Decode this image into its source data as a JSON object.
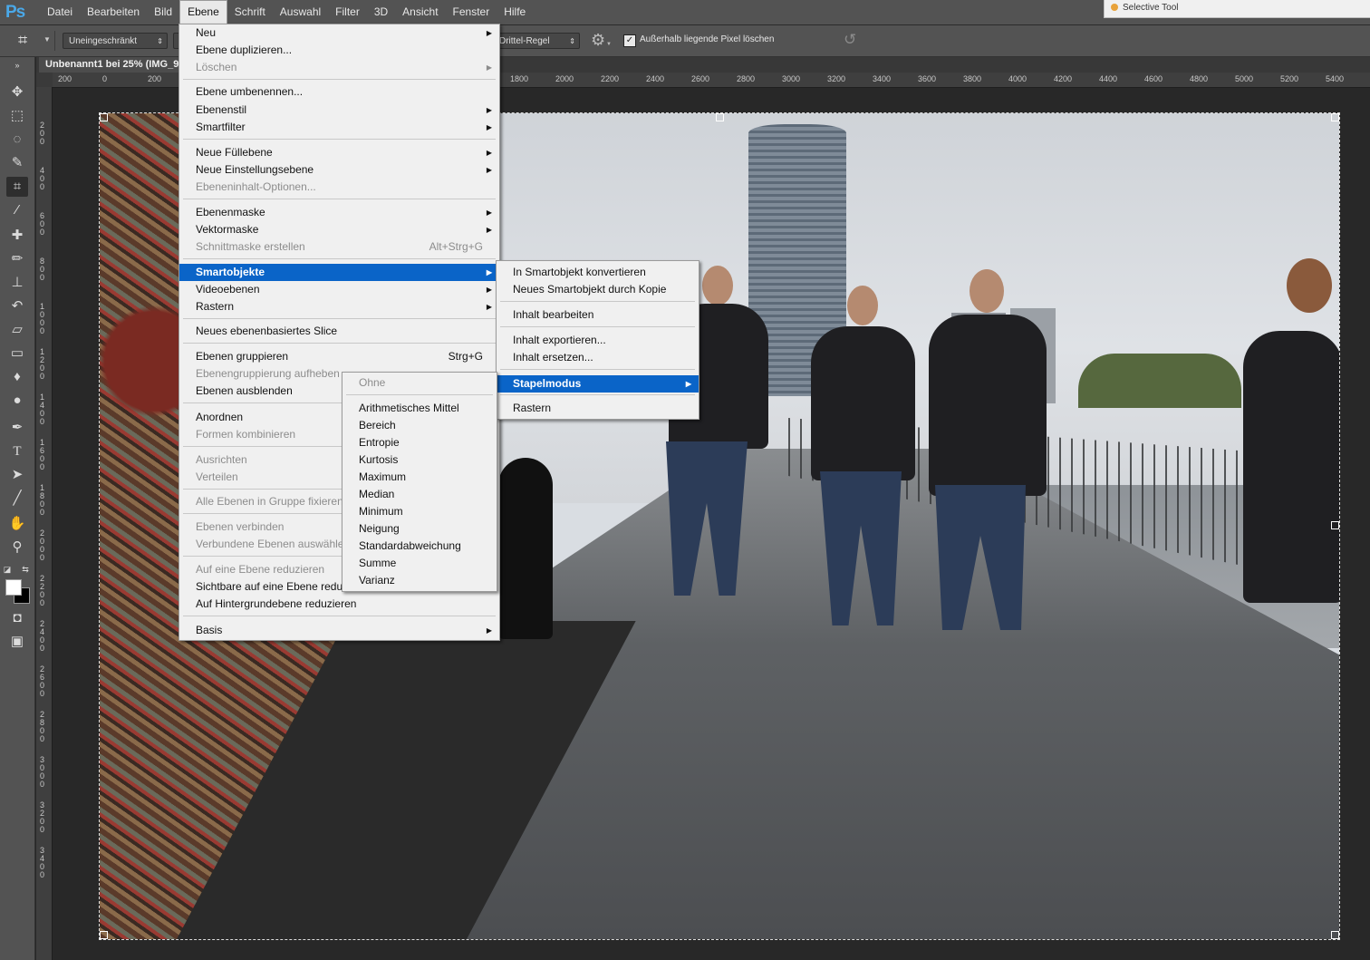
{
  "app": {
    "logo": "Ps"
  },
  "menubar": {
    "items": [
      "Datei",
      "Bearbeiten",
      "Bild",
      "Ebene",
      "Schrift",
      "Auswahl",
      "Filter",
      "3D",
      "Ansicht",
      "Fenster",
      "Hilfe"
    ],
    "active": "Ebene"
  },
  "selective_tool": {
    "label": "Selective Tool"
  },
  "options": {
    "ratio_value": "Uneingeschränkt",
    "overlay_value": "Drittel-Regel",
    "delete_pixels_label": "Außerhalb liegende Pixel löschen",
    "delete_pixels_checked": true
  },
  "document": {
    "tab_title": "Unbenannt1 bei 25% (IMG_9"
  },
  "ruler": {
    "h_ticks": [
      "200",
      "0",
      "200",
      "1800",
      "2000",
      "2200",
      "2400",
      "2600",
      "2800",
      "3000",
      "3200",
      "3400",
      "3600",
      "3800",
      "4000",
      "4200",
      "4400",
      "4600",
      "4800",
      "5000",
      "5200",
      "5400"
    ],
    "v_ticks": [
      "200",
      "400",
      "600",
      "800",
      "1000",
      "1200",
      "1400",
      "1600",
      "1800",
      "2000",
      "2200",
      "2400",
      "2600",
      "2800",
      "3000",
      "3200",
      "3400"
    ]
  },
  "ebene_menu": {
    "items": [
      {
        "label": "Neu",
        "submenu": true
      },
      {
        "label": "Ebene duplizieren..."
      },
      {
        "label": "Löschen",
        "submenu": true,
        "disabled": true
      },
      {
        "label": "Ebene umbenennen..."
      },
      {
        "label": "Ebenenstil",
        "submenu": true
      },
      {
        "label": "Smartfilter",
        "submenu": true
      },
      {
        "label": "Neue Füllebene",
        "submenu": true
      },
      {
        "label": "Neue Einstellungsebene",
        "submenu": true
      },
      {
        "label": "Ebeneninhalt-Optionen...",
        "disabled": true
      },
      {
        "label": "Ebenenmaske",
        "submenu": true
      },
      {
        "label": "Vektormaske",
        "submenu": true
      },
      {
        "label": "Schnittmaske erstellen",
        "shortcut": "Alt+Strg+G",
        "disabled": true
      },
      {
        "label": "Smartobjekte",
        "submenu": true,
        "highlighted": true
      },
      {
        "label": "Videoebenen",
        "submenu": true
      },
      {
        "label": "Rastern",
        "submenu": true
      },
      {
        "label": "Neues ebenenbasiertes Slice"
      },
      {
        "label": "Ebenen gruppieren",
        "shortcut": "Strg+G"
      },
      {
        "label": "Ebenengruppierung aufheben",
        "disabled": true
      },
      {
        "label": "Ebenen ausblenden"
      },
      {
        "label": "Anordnen"
      },
      {
        "label": "Formen kombinieren",
        "disabled": true
      },
      {
        "label": "Ausrichten",
        "disabled": true
      },
      {
        "label": "Verteilen",
        "disabled": true
      },
      {
        "label": "Alle Ebenen in Gruppe fixieren...",
        "disabled": true
      },
      {
        "label": "Ebenen verbinden",
        "disabled": true
      },
      {
        "label": "Verbundene Ebenen auswählen",
        "disabled": true
      },
      {
        "label": "Auf eine Ebene reduzieren",
        "disabled": true
      },
      {
        "label": "Sichtbare auf eine Ebene reduzieren"
      },
      {
        "label": "Auf Hintergrundebene reduzieren"
      },
      {
        "label": "Basis",
        "submenu": true
      }
    ]
  },
  "smartobjekte_menu": {
    "items": [
      {
        "label": "In Smartobjekt konvertieren"
      },
      {
        "label": "Neues Smartobjekt durch Kopie"
      },
      {
        "label": "Inhalt bearbeiten"
      },
      {
        "label": "Inhalt exportieren..."
      },
      {
        "label": "Inhalt ersetzen..."
      },
      {
        "label": "Stapelmodus",
        "submenu": true,
        "highlighted": true
      },
      {
        "label": "Rastern"
      }
    ]
  },
  "stapelmodus_menu": {
    "items": [
      {
        "label": "Ohne",
        "disabled": true
      },
      {
        "label": "Arithmetisches Mittel"
      },
      {
        "label": "Bereich"
      },
      {
        "label": "Entropie"
      },
      {
        "label": "Kurtosis"
      },
      {
        "label": "Maximum"
      },
      {
        "label": "Median"
      },
      {
        "label": "Minimum"
      },
      {
        "label": "Neigung"
      },
      {
        "label": "Standardabweichung"
      },
      {
        "label": "Summe"
      },
      {
        "label": "Varianz"
      }
    ]
  },
  "tools": [
    "move-tool",
    "marquee-tool",
    "lasso-tool",
    "quick-selection-tool",
    "crop-tool",
    "eyedropper-tool",
    "healing-brush-tool",
    "brush-tool",
    "clone-stamp-tool",
    "history-brush-tool",
    "eraser-tool",
    "gradient-tool",
    "blur-tool",
    "dodge-tool",
    "pen-tool",
    "type-tool",
    "path-selection-tool",
    "line-tool",
    "hand-tool",
    "zoom-tool"
  ],
  "colors": {
    "menu_highlight": "#0a64c8",
    "chrome": "#535353",
    "swatch_foreground": "#ffffff",
    "swatch_background": "#000000"
  }
}
